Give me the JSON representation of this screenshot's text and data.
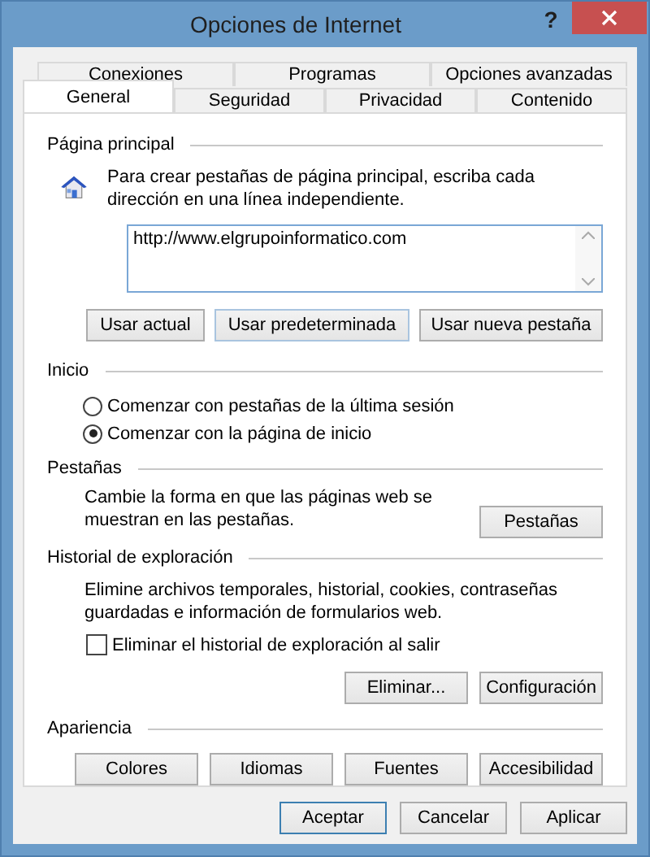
{
  "window": {
    "title": "Opciones de Internet",
    "help": "?"
  },
  "tab_rows": [
    [
      {
        "label": "Conexiones",
        "selected": false
      },
      {
        "label": "Programas",
        "selected": false
      },
      {
        "label": "Opciones avanzadas",
        "selected": false
      }
    ],
    [
      {
        "label": "General",
        "selected": true
      },
      {
        "label": "Seguridad",
        "selected": false
      },
      {
        "label": "Privacidad",
        "selected": false
      },
      {
        "label": "Contenido",
        "selected": false
      }
    ]
  ],
  "sections": [
    {
      "kind": "home",
      "title": "Página principal",
      "text": "Para crear pestañas de página principal, escriba cada dirección en una línea independiente.",
      "address": "http://www.elgrupoinformatico.com",
      "buttons": [
        {
          "label": "Usar actual",
          "focused": false
        },
        {
          "label": "Usar predeterminada",
          "focused": true
        },
        {
          "label": "Usar nueva pestaña",
          "focused": false
        }
      ]
    },
    {
      "kind": "radios",
      "title": "Inicio",
      "options": [
        {
          "label": "Comenzar con pestañas de la última sesión",
          "selected": false
        },
        {
          "label": "Comenzar con la página de inicio",
          "selected": true
        }
      ]
    },
    {
      "kind": "text_button",
      "title": "Pestañas",
      "text": "Cambie la forma en que las páginas web se muestran en las pestañas.",
      "buttons": [
        {
          "label": "Pestañas",
          "focused": false
        }
      ]
    },
    {
      "kind": "history",
      "title": "Historial de exploración",
      "text": "Elimine archivos temporales, historial, cookies, contraseñas guardadas e información de formularios web.",
      "checkbox": {
        "label": "Eliminar el historial de exploración al salir",
        "checked": false
      },
      "buttons": [
        {
          "label": "Eliminar...",
          "focused": false
        },
        {
          "label": "Configuración",
          "focused": false
        }
      ]
    },
    {
      "kind": "buttons",
      "title": "Apariencia",
      "buttons": [
        {
          "label": "Colores",
          "focused": false
        },
        {
          "label": "Idiomas",
          "focused": false
        },
        {
          "label": "Fuentes",
          "focused": false
        },
        {
          "label": "Accesibilidad",
          "focused": false
        }
      ]
    }
  ],
  "dialog_buttons": [
    {
      "label": "Aceptar",
      "default": true
    },
    {
      "label": "Cancelar",
      "default": false
    },
    {
      "label": "Aplicar",
      "default": false
    }
  ]
}
